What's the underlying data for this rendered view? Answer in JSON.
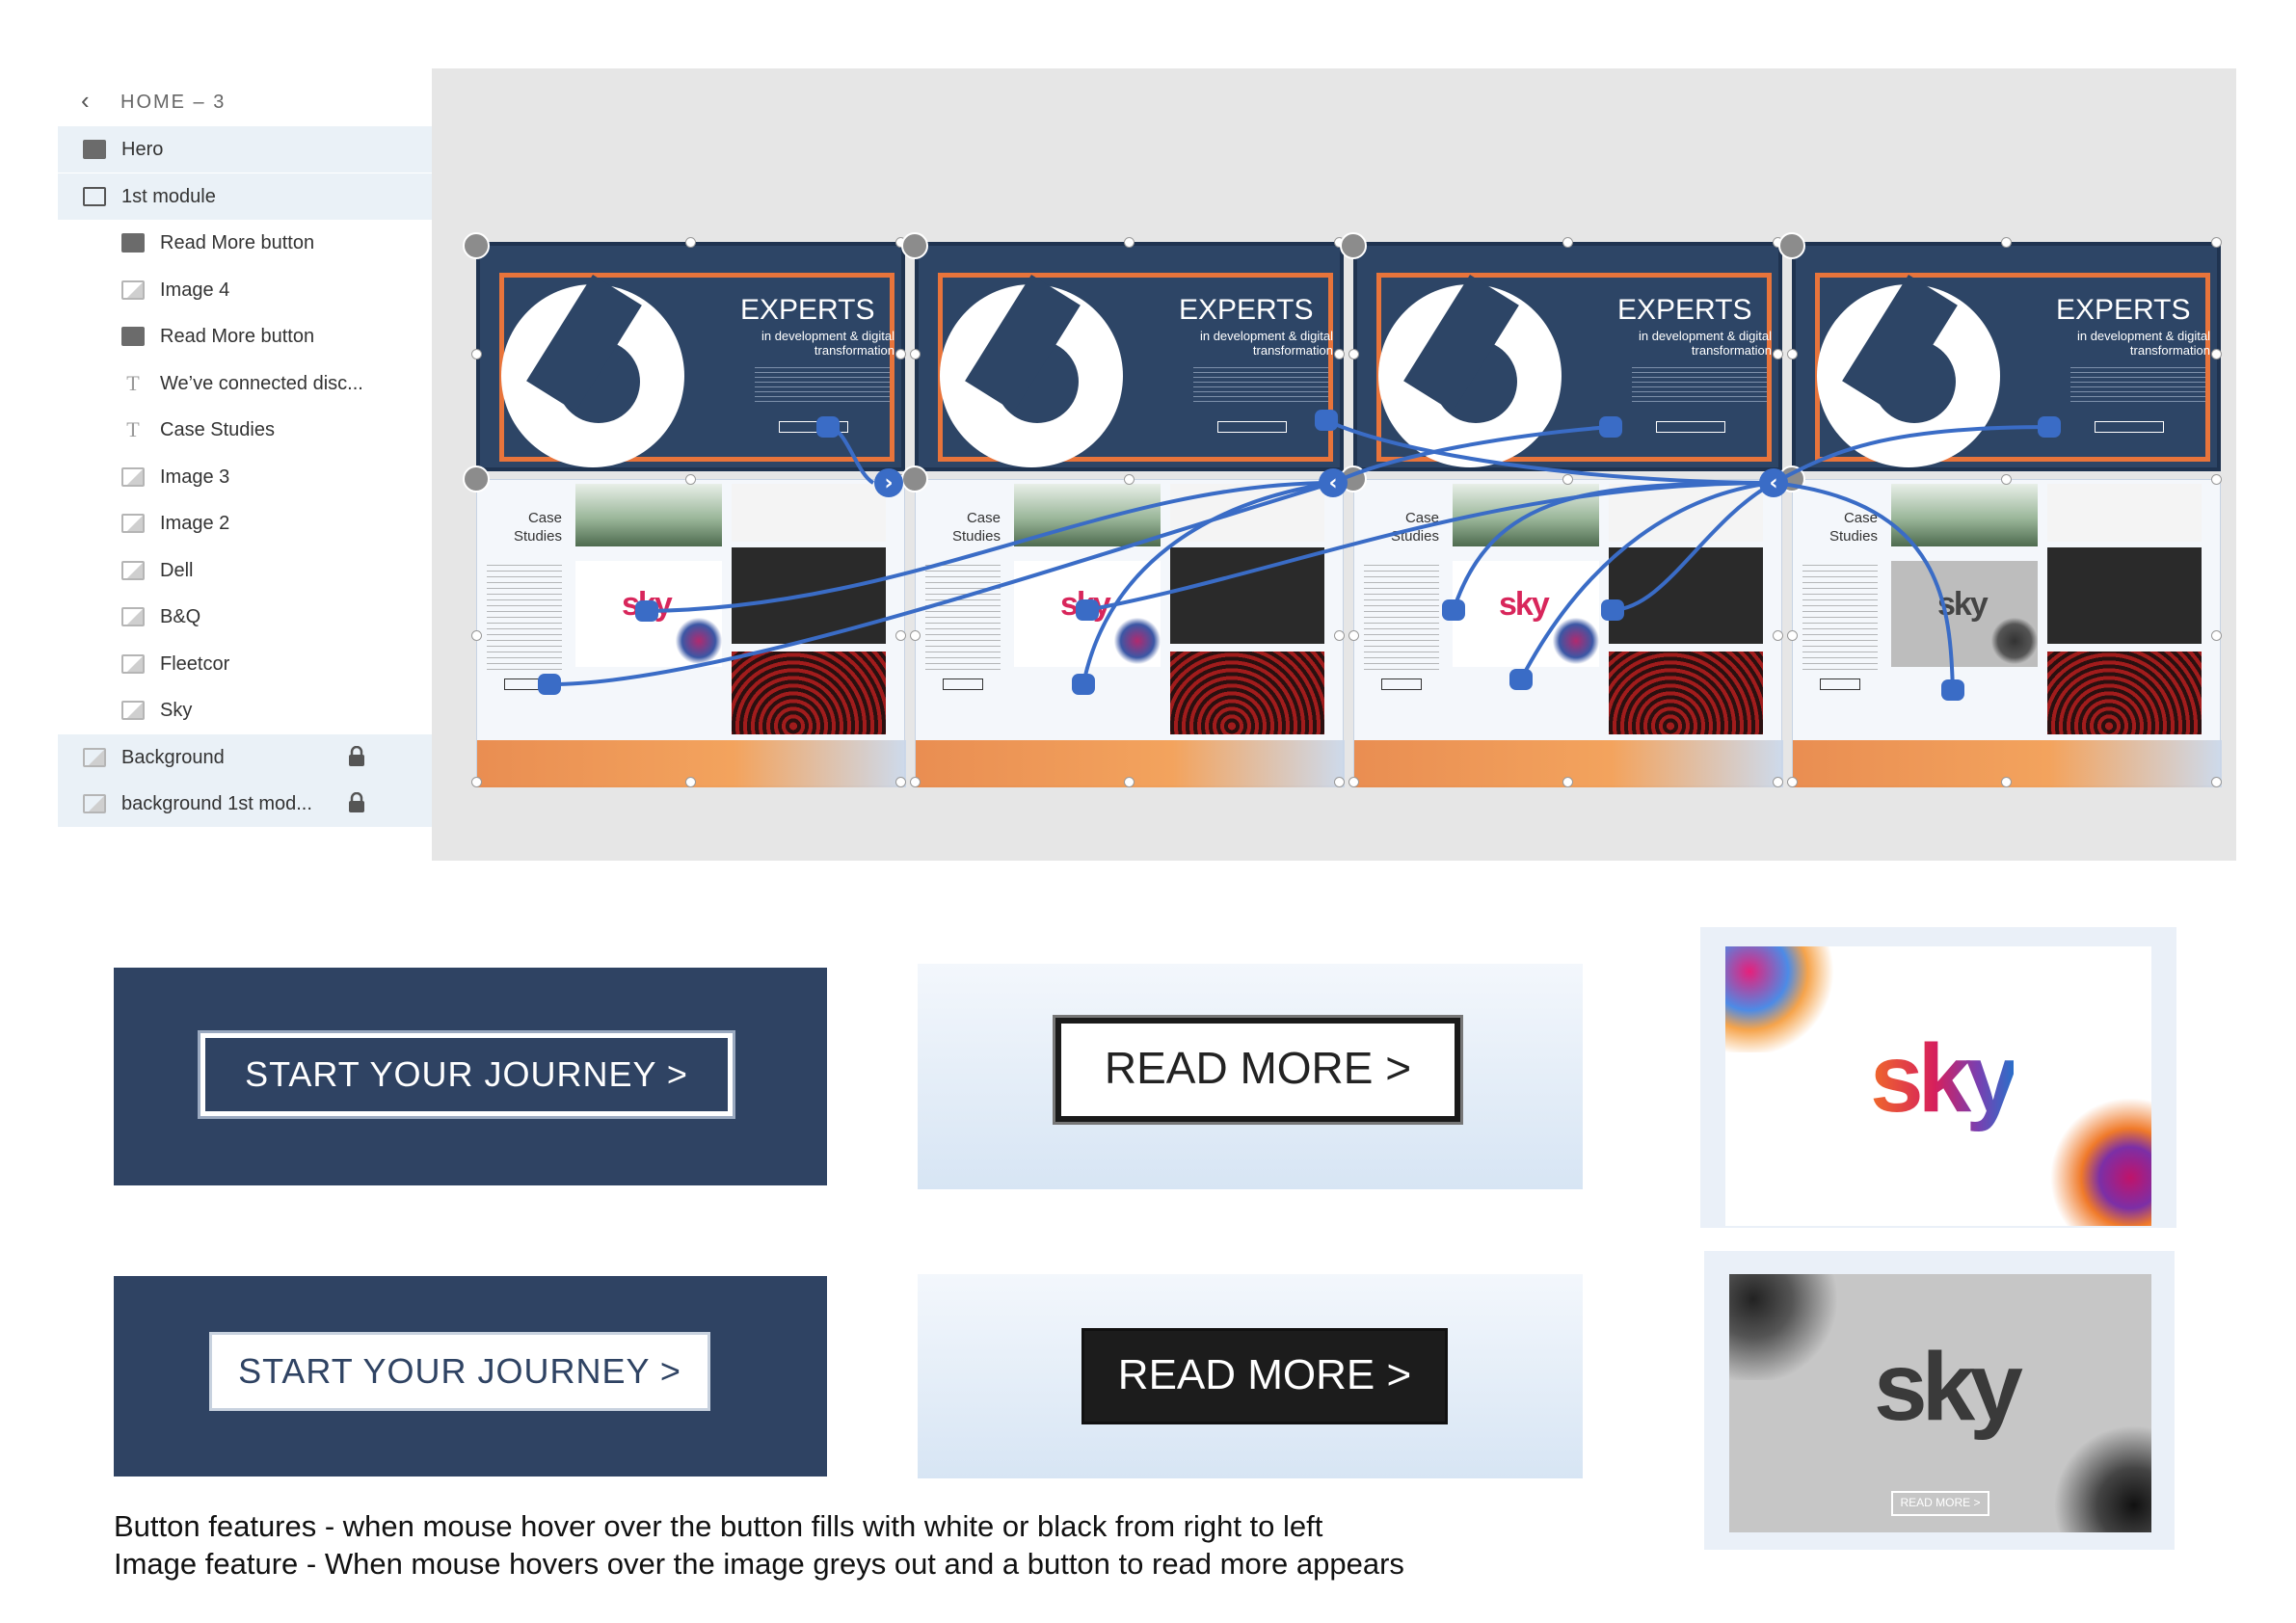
{
  "layers_panel": {
    "back_icon": "chevron-left-icon",
    "title": "HOME – 3",
    "items": [
      {
        "label": "Hero",
        "icon": "folder-filled-icon",
        "indent": 0,
        "selected": true,
        "locked": false
      },
      {
        "label": "1st module",
        "icon": "folder-outline-icon",
        "indent": 0,
        "selected": true,
        "locked": false
      },
      {
        "label": "Read More button",
        "icon": "folder-filled-icon",
        "indent": 1,
        "selected": false,
        "locked": false
      },
      {
        "label": "Image 4",
        "icon": "image-icon",
        "indent": 1,
        "selected": false,
        "locked": false
      },
      {
        "label": "Read More button",
        "icon": "folder-filled-icon",
        "indent": 1,
        "selected": false,
        "locked": false
      },
      {
        "label": "We’ve connected  disc...",
        "icon": "text-icon",
        "indent": 1,
        "selected": false,
        "locked": false
      },
      {
        "label": "Case Studies",
        "icon": "text-icon",
        "indent": 1,
        "selected": false,
        "locked": false
      },
      {
        "label": "Image 3",
        "icon": "image-icon",
        "indent": 1,
        "selected": false,
        "locked": false
      },
      {
        "label": "Image 2",
        "icon": "image-icon",
        "indent": 1,
        "selected": false,
        "locked": false
      },
      {
        "label": "Dell",
        "icon": "image-icon",
        "indent": 1,
        "selected": false,
        "locked": false
      },
      {
        "label": "B&Q",
        "icon": "image-icon",
        "indent": 1,
        "selected": false,
        "locked": false
      },
      {
        "label": "Fleetcor",
        "icon": "image-icon",
        "indent": 1,
        "selected": false,
        "locked": false
      },
      {
        "label": "Sky",
        "icon": "image-icon",
        "indent": 1,
        "selected": false,
        "locked": false
      },
      {
        "label": "Background",
        "icon": "image-icon",
        "indent": 0,
        "selected": true,
        "locked": true
      },
      {
        "label": "background 1st mod...",
        "icon": "image-icon",
        "indent": 0,
        "selected": true,
        "locked": true
      }
    ]
  },
  "artboard": {
    "hero_title": "EXPERTS",
    "hero_subtitle": "in development & digital transformation",
    "case_title": "Case Studies",
    "sky_logo": "sky",
    "accent_color": "#3a6cc6",
    "navy_color": "#2d4566",
    "orange_color": "#e8743b"
  },
  "showcase": {
    "start_journey_outline": "START YOUR JOURNEY >",
    "start_journey_filled": "START YOUR JOURNEY >",
    "read_more_outline": "READ MORE >",
    "read_more_filled": "READ MORE >",
    "sky_logo": "sky",
    "sky_grey_logo": "sky",
    "sky_grey_button": "READ MORE >"
  },
  "notes": {
    "button_feature": "Button features - when mouse hover over the button fills with white or black from right to left",
    "image_feature": "Image feature - When mouse hovers over the image greys out and a button to read more appears"
  }
}
